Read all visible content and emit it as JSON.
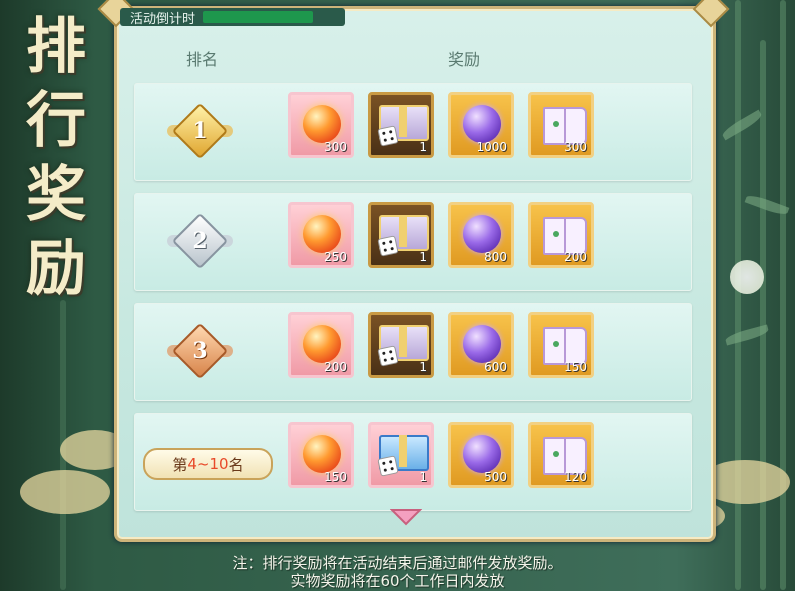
{
  "panel": {
    "countdown_label": "活动倒计时",
    "header_rank": "排名",
    "header_reward": "奖励"
  },
  "side_title": [
    "排",
    "行",
    "奖",
    "励"
  ],
  "rows": [
    {
      "rank_label": "1",
      "badge": "gold",
      "rewards": [
        "300",
        "1",
        "1000",
        "300"
      ]
    },
    {
      "rank_label": "2",
      "badge": "silver",
      "rewards": [
        "250",
        "1",
        "800",
        "200"
      ]
    },
    {
      "rank_label": "3",
      "badge": "bronze",
      "rewards": [
        "200",
        "1",
        "600",
        "150"
      ]
    },
    {
      "rank_prefix": "第",
      "rank_range": "4~10",
      "rank_suffix": "名",
      "badge": "text",
      "rewards": [
        "150",
        "1",
        "500",
        "120"
      ]
    }
  ],
  "notes": {
    "line1": "注：排行奖励将在活动结束后通过邮件发放奖励。",
    "line2": "实物奖励将在60个工作日内发放"
  },
  "colors": {
    "frame_gold": "#cdb47a",
    "panel_mint": "#c7e8e0",
    "countdown_bar": "#1ca24e"
  }
}
